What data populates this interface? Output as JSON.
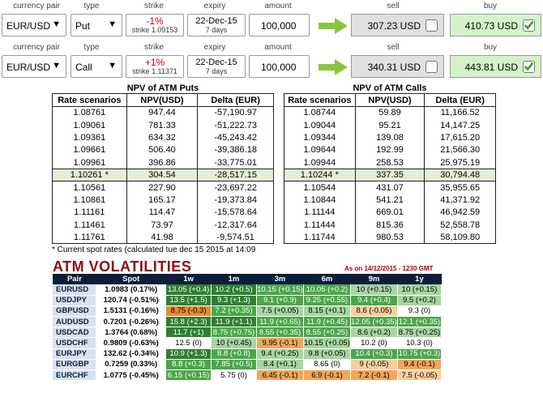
{
  "headers": {
    "currency_pair": "currency pair",
    "type": "type",
    "strike": "strike",
    "expiry": "expiry",
    "amount": "amount",
    "sell": "sell",
    "buy": "buy"
  },
  "rows": [
    {
      "pair": "EUR/USD",
      "type": "Put",
      "strike_pct": "-1%",
      "strike_value": "strike 1.09153",
      "expiry_date": "22-Dec-15",
      "expiry_days": "7 days",
      "amount": "100,000",
      "sell": "307.23 USD",
      "buy": "410.73 USD",
      "sell_checked": false,
      "buy_checked": true
    },
    {
      "pair": "EUR/USD",
      "type": "Call",
      "strike_pct": "+1%",
      "strike_value": "strike 1.11371",
      "expiry_date": "22-Dec-15",
      "expiry_days": "7 days",
      "amount": "100,000",
      "sell": "340.31 USD",
      "buy": "443.81 USD",
      "sell_checked": false,
      "buy_checked": true
    }
  ],
  "puts_table": {
    "title": "NPV of ATM Puts",
    "columns": [
      "Rate scenarios",
      "NPV(USD)",
      "Delta (EUR)"
    ],
    "rows": [
      [
        "1.08761",
        "947.44",
        "-57,190.97"
      ],
      [
        "1.09061",
        "781.33",
        "-51,222.73"
      ],
      [
        "1.09361",
        "634.32",
        "-45,243.42"
      ],
      [
        "1.09661",
        "506.40",
        "-39,386.18"
      ],
      [
        "1.09961",
        "396.86",
        "-33,775.01"
      ],
      [
        "1.10261 *",
        "304.54",
        "-28,517.15"
      ],
      [
        "1.10561",
        "227.90",
        "-23,697.22"
      ],
      [
        "1.10861",
        "165.17",
        "-19,373.84"
      ],
      [
        "1.11161",
        "114.47",
        "-15,578.64"
      ],
      [
        "1.11461",
        "73.97",
        "-12,317.64"
      ],
      [
        "1.11761",
        "41.98",
        "-9,574.51"
      ]
    ],
    "highlight_row": 5
  },
  "calls_table": {
    "title": "NPV of ATM Calls",
    "columns": [
      "Rate scenarios",
      "NPV(USD)",
      "Delta (EUR)"
    ],
    "rows": [
      [
        "1.08744",
        "59.89",
        "11,166.52"
      ],
      [
        "1.09044",
        "95.21",
        "14,147.25"
      ],
      [
        "1.09344",
        "139.08",
        "17,615.20"
      ],
      [
        "1.09644",
        "192.99",
        "21,566.30"
      ],
      [
        "1.09944",
        "258.53",
        "25,975.19"
      ],
      [
        "1.10244 *",
        "337.35",
        "30,794.48"
      ],
      [
        "1.10544",
        "431.07",
        "35,955.65"
      ],
      [
        "1.10844",
        "541.21",
        "41,371.92"
      ],
      [
        "1.11144",
        "669.01",
        "46,942.59"
      ],
      [
        "1.11444",
        "815.36",
        "52,558.78"
      ],
      [
        "1.11744",
        "980.53",
        "58,109.80"
      ]
    ],
    "highlight_row": 5
  },
  "footnote": "* Current spot rates (calculated tue dec 15 2015 at 14:09",
  "volatilities": {
    "title": "ATM VOLATILITIES",
    "as_of": "As on 14/12/2015 - 1230 GMT",
    "columns": [
      "Pair",
      "Spot",
      "1w",
      "1m",
      "3m",
      "6m",
      "9m",
      "1y"
    ],
    "rows": [
      {
        "pair": "EURUSD",
        "spot": "1.0983 (0.17%)",
        "cells": [
          [
            "13.05 (+0.4)",
            "dg"
          ],
          [
            "10.2 (+0.5)",
            "dg"
          ],
          [
            "10.15 (+0.15)",
            "g"
          ],
          [
            "10.05 (+0.2)",
            "g"
          ],
          [
            "10 (+0.15)",
            "lg"
          ],
          [
            "10 (+0.15)",
            "lg"
          ]
        ]
      },
      {
        "pair": "USDJPY",
        "spot": "120.74 (-0.51%)",
        "cells": [
          [
            "13.5 (+1.5)",
            "dg"
          ],
          [
            "9.3 (+1.3)",
            "dg"
          ],
          [
            "9.1 (+0.9)",
            "g"
          ],
          [
            "9.25 (+0.55)",
            "g"
          ],
          [
            "9.4 (+0.4)",
            "g"
          ],
          [
            "9.5 (+0.2)",
            "lg"
          ]
        ]
      },
      {
        "pair": "GBPUSD",
        "spot": "1.5131 (-0.16%)",
        "cells": [
          [
            "8.75 (-0.3)",
            "do"
          ],
          [
            "7.2 (+0.35)",
            "g"
          ],
          [
            "7.5 (+0.05)",
            "lg"
          ],
          [
            "8.15 (+0.1)",
            "lg"
          ],
          [
            "8.6 (-0.05)",
            "lo"
          ],
          [
            "9.3 (0)",
            "w"
          ]
        ]
      },
      {
        "pair": "AUDUSD",
        "spot": "0.7201 (-0.26%)",
        "cells": [
          [
            "15.8 (+2.3)",
            "dg"
          ],
          [
            "11.9 (+1.1)",
            "dg"
          ],
          [
            "11.9 (+0.65)",
            "g"
          ],
          [
            "11.9 (+0.45)",
            "g"
          ],
          [
            "12.05 (+0.35)",
            "g"
          ],
          [
            "12.1 (+0.35)",
            "g"
          ]
        ]
      },
      {
        "pair": "USDCAD",
        "spot": "1.3764 (0.68%)",
        "cells": [
          [
            "11.7 (+1)",
            "dg"
          ],
          [
            "8.75 (+0.75)",
            "g"
          ],
          [
            "8.55 (+0.35)",
            "g"
          ],
          [
            "8.55 (+0.25)",
            "g"
          ],
          [
            "8.6 (+0.2)",
            "lg"
          ],
          [
            "8.75 (+0.25)",
            "lg"
          ]
        ]
      },
      {
        "pair": "USDCHF",
        "spot": "0.9809 (-0.63%)",
        "cells": [
          [
            "12.5 (0)",
            "w"
          ],
          [
            "10 (+0.45)",
            "lg"
          ],
          [
            "9.95 (-0.1)",
            "o"
          ],
          [
            "10.15 (+0.05)",
            "lg"
          ],
          [
            "10.2 (0)",
            "w"
          ],
          [
            "10.3 (0)",
            "w"
          ]
        ]
      },
      {
        "pair": "EURJPY",
        "spot": "132.62 (-0.34%)",
        "cells": [
          [
            "10.9 (+1.3)",
            "dg"
          ],
          [
            "8.8 (+0.8)",
            "g"
          ],
          [
            "9.4 (+0.25)",
            "lg"
          ],
          [
            "9.8 (+0.05)",
            "lg"
          ],
          [
            "10.4 (+0.3)",
            "g"
          ],
          [
            "10.75 (+0.3)",
            "g"
          ]
        ]
      },
      {
        "pair": "EURGBP",
        "spot": "0.7259 (0.33%)",
        "cells": [
          [
            "8.8 (+0.3)",
            "g"
          ],
          [
            "7.85 (+0.5)",
            "g"
          ],
          [
            "8.4 (+0.1)",
            "lg"
          ],
          [
            "8.65 (0)",
            "w"
          ],
          [
            "9 (-0.05)",
            "lo"
          ],
          [
            "9.4 (-0.1)",
            "o"
          ]
        ]
      },
      {
        "pair": "EURCHF",
        "spot": "1.0775 (-0.45%)",
        "cells": [
          [
            "6.15 (+0.15)",
            "g"
          ],
          [
            "5.75 (0)",
            "w"
          ],
          [
            "6.45 (-0.1)",
            "o"
          ],
          [
            "6.9 (-0.1)",
            "o"
          ],
          [
            "7.2 (-0.1)",
            "o"
          ],
          [
            "7.5 (-0.05)",
            "lo"
          ]
        ]
      }
    ]
  },
  "colors": {
    "strike_red": "#c00000",
    "buy_bg": "#d5f3c8",
    "sell_bg": "#e0e0e0",
    "arrow_green": "#8cc63f",
    "vol_title": "#8b0d14",
    "vol_header": "#0c1e3a"
  },
  "icons": {
    "arrow": "right-arrow-icon",
    "check": "checkmark-icon",
    "dropdown": "triangle-down-icon"
  }
}
